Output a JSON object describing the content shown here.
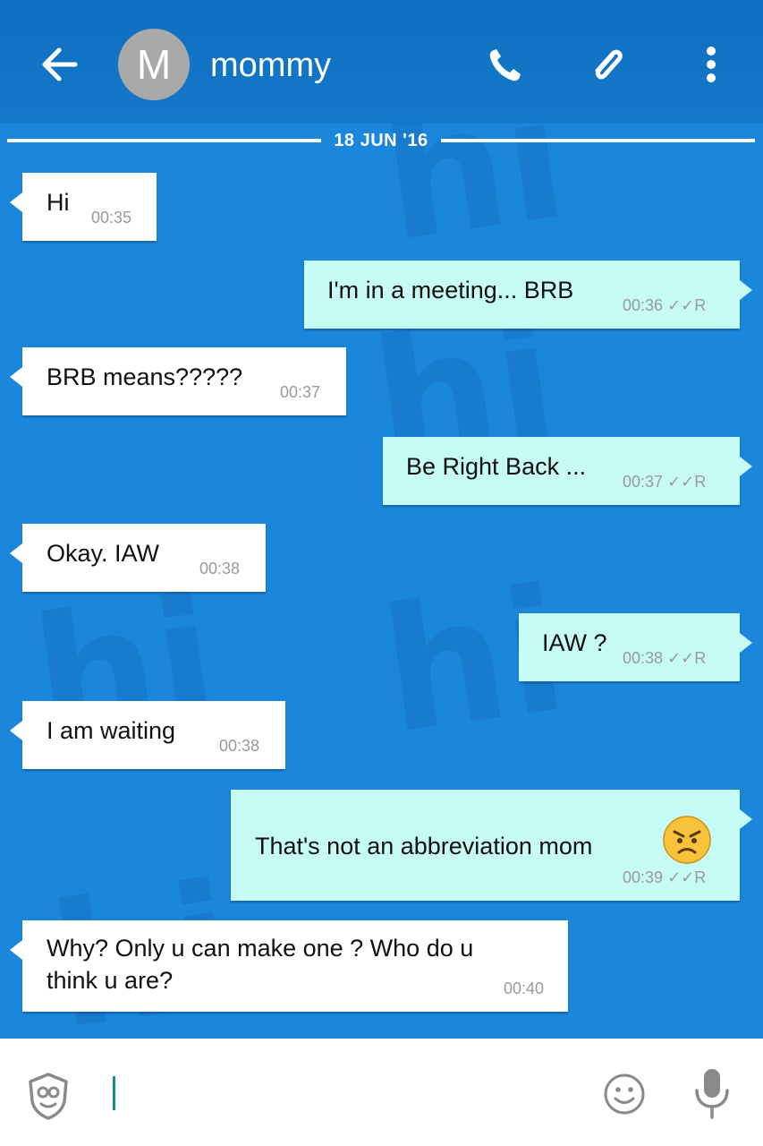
{
  "header": {
    "avatar_letter": "M",
    "contact_name": "mommy",
    "icons": [
      "back-arrow-icon",
      "phone-icon",
      "paperclip-icon",
      "more-vert-icon"
    ]
  },
  "chat": {
    "date_divider": "18 JUN '16",
    "watermark": "hi",
    "messages": [
      {
        "dir": "in",
        "text": "Hi",
        "time": "00:35"
      },
      {
        "dir": "out",
        "text": "I'm in a meeting... BRB",
        "time": "00:36",
        "status": "R"
      },
      {
        "dir": "in",
        "text": "BRB means?????",
        "time": "00:37"
      },
      {
        "dir": "out",
        "text": "Be Right Back ...",
        "time": "00:37",
        "status": "R"
      },
      {
        "dir": "in",
        "text": "Okay. IAW",
        "time": "00:38"
      },
      {
        "dir": "out",
        "text": "IAW ?",
        "time": "00:38",
        "status": "R"
      },
      {
        "dir": "in",
        "text": "I am waiting",
        "time": "00:38"
      },
      {
        "dir": "out",
        "text": "That's not an abbreviation mom",
        "emoji": "angry-face-emoji",
        "time": "00:39",
        "status": "R"
      },
      {
        "dir": "in",
        "text_line1": "Why? Only u can make one ? Who do u",
        "text_line2": "think u are?",
        "time": "00:40"
      }
    ]
  },
  "input_bar": {
    "icons": [
      "sticker-face-icon",
      "emoji-smiley-icon",
      "microphone-icon"
    ]
  },
  "colors": {
    "header": "#1174c5",
    "chat_background": "#1a86dc",
    "incoming_bubble": "#ffffff",
    "outgoing_bubble": "#c6fbf6",
    "timestamp": "#9a9a9a"
  }
}
